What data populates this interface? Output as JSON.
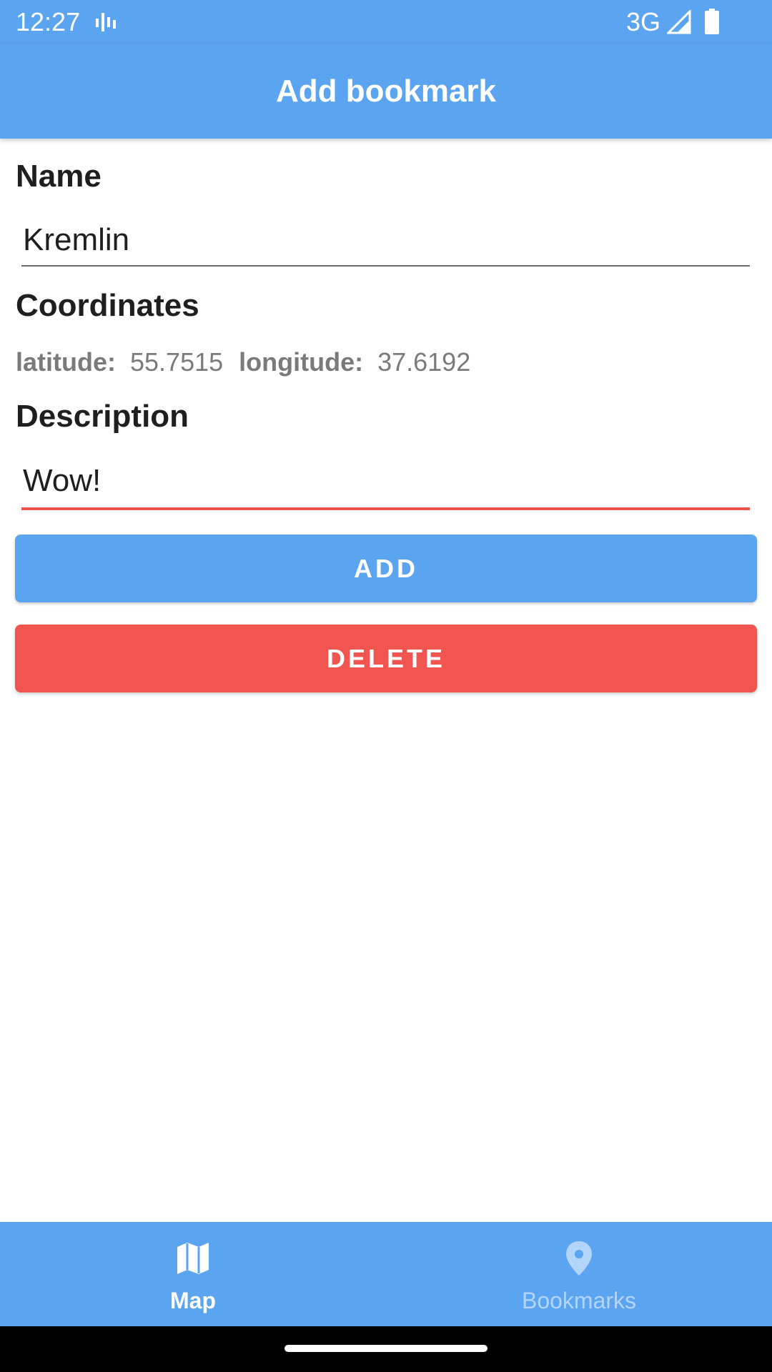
{
  "status_bar": {
    "time": "12:27",
    "network": "3G",
    "icons": [
      "activity-icon",
      "signal-icon",
      "battery-icon"
    ]
  },
  "app_bar": {
    "title": "Add bookmark"
  },
  "form": {
    "name_label": "Name",
    "name_value": "Kremlin",
    "coordinates_label": "Coordinates",
    "latitude_label": "latitude:",
    "latitude_value": "55.7515",
    "longitude_label": "longitude:",
    "longitude_value": "37.6192",
    "description_label": "Description",
    "description_value": "Wow!"
  },
  "buttons": {
    "add": "ADD",
    "delete": "DELETE"
  },
  "bottom_nav": {
    "items": [
      {
        "label": "Map",
        "icon": "map-icon",
        "active": true
      },
      {
        "label": "Bookmarks",
        "icon": "location-pin-icon",
        "active": false
      }
    ]
  },
  "colors": {
    "primary": "#5BA4F0",
    "danger": "#F0554F",
    "inactive_nav": "#B4D5FA",
    "text": "#1f1f1f",
    "muted": "#7a7a7a"
  }
}
